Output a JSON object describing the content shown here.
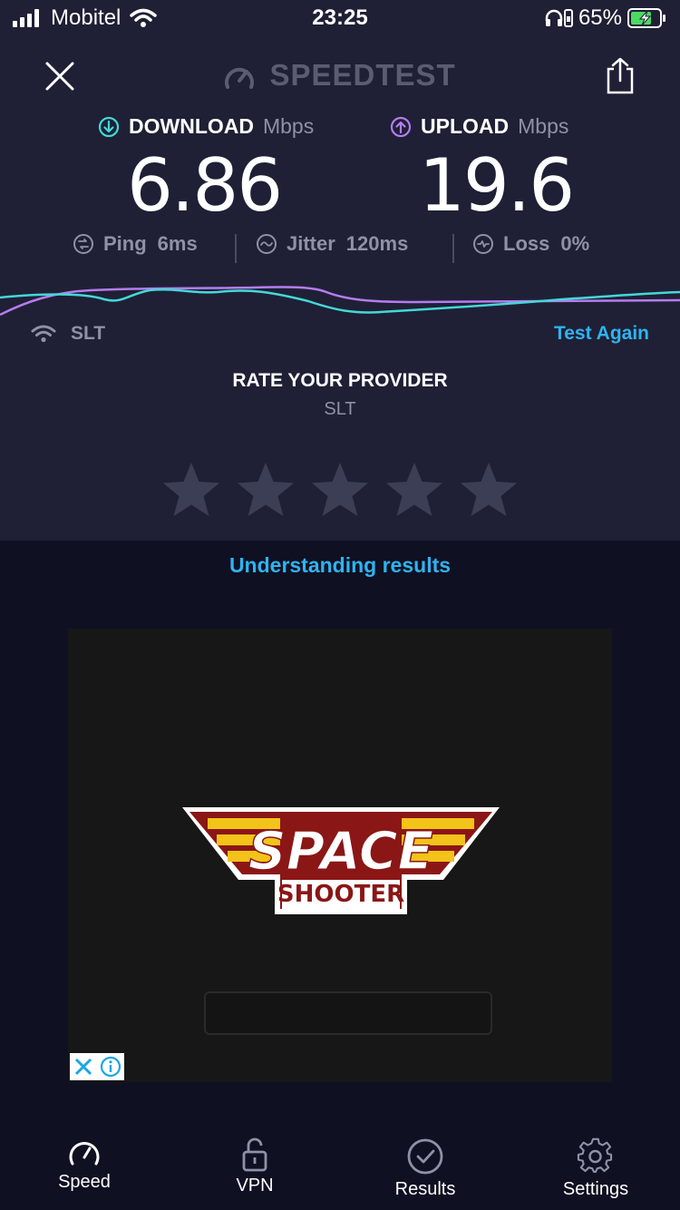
{
  "status_bar": {
    "carrier": "Mobitel",
    "time": "23:25",
    "battery": "65%"
  },
  "header": {
    "brand": "SPEEDTEST",
    "close_icon": "close-icon",
    "share_icon": "share-icon"
  },
  "download": {
    "label": "DOWNLOAD",
    "unit": "Mbps",
    "value": "6.86"
  },
  "upload": {
    "label": "UPLOAD",
    "unit": "Mbps",
    "value": "19.6"
  },
  "metrics": [
    {
      "name": "Ping",
      "value": "6ms"
    },
    {
      "name": "Jitter",
      "value": "120ms"
    },
    {
      "name": "Loss",
      "value": "0%"
    }
  ],
  "network": {
    "name": "SLT",
    "test_again": "Test Again"
  },
  "rating": {
    "title": "RATE YOUR PROVIDER",
    "provider": "SLT",
    "stars": 5,
    "selected": 0
  },
  "understanding_link": "Understanding results",
  "ad": {
    "title_line1": "SPACE",
    "title_line2": "SHOOTER"
  },
  "tabs": [
    {
      "label": "Speed",
      "icon": "speedometer-icon"
    },
    {
      "label": "VPN",
      "icon": "lock-icon"
    },
    {
      "label": "Results",
      "icon": "checkmark-circle-icon"
    },
    {
      "label": "Settings",
      "icon": "gear-icon"
    }
  ],
  "colors": {
    "accent_blue": "#2eb4f0",
    "download": "#44d8d8",
    "upload": "#b67cf0",
    "panel": "#1f2035",
    "background": "#0f1022"
  }
}
